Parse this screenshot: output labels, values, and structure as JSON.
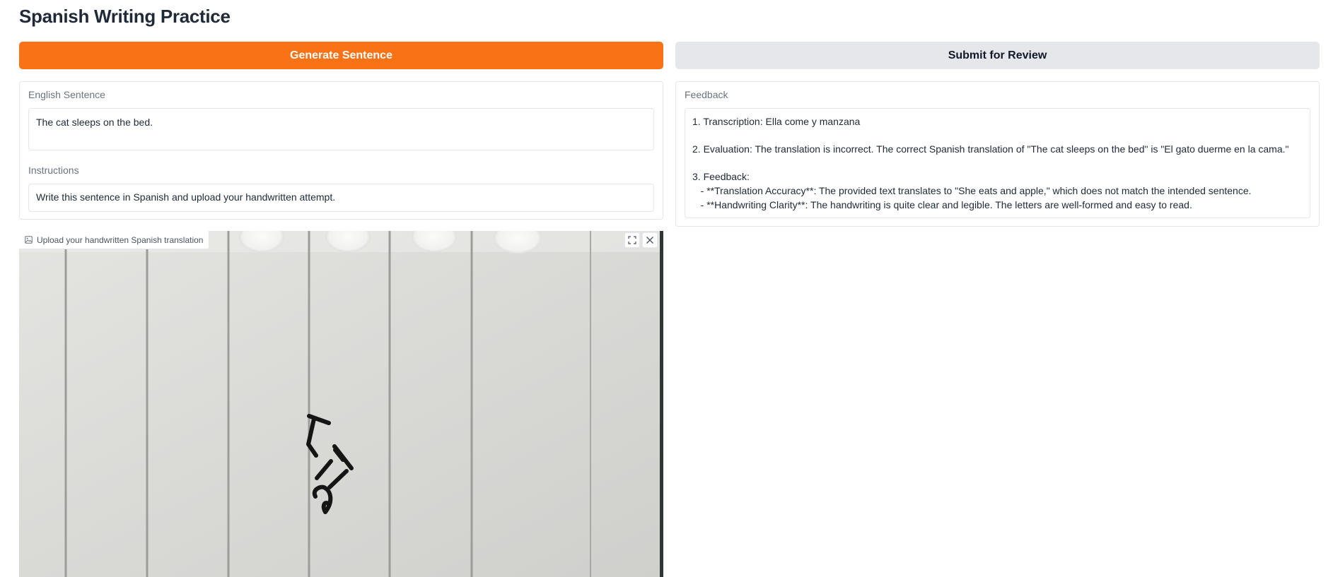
{
  "app": {
    "title": "Spanish Writing Practice"
  },
  "buttons": {
    "generate_label": "Generate Sentence",
    "submit_label": "Submit for Review"
  },
  "english": {
    "label": "English Sentence",
    "value": "The cat sleeps on the bed."
  },
  "instructions": {
    "label": "Instructions",
    "value": "Write this sentence in Spanish and upload your handwritten attempt."
  },
  "feedback": {
    "label": "Feedback",
    "lines": [
      "1. Transcription: Ella come y manzana",
      "",
      "2. Evaluation: The translation is incorrect. The correct Spanish translation of \"The cat sleeps on the bed\" is \"El gato duerme en la cama.\"",
      "",
      "3. Feedback:",
      "   - **Translation Accuracy**: The provided text translates to \"She eats and apple,\" which does not match the intended sentence.",
      "   - **Handwriting Clarity**: The handwriting is quite clear and legible. The letters are well-formed and easy to read."
    ]
  },
  "upload": {
    "label": "Upload your handwritten Spanish translation",
    "handwritten_text": "Ella"
  },
  "icons": {
    "image": "image-icon",
    "fullscreen": "fullscreen-icon",
    "close": "close-icon"
  },
  "colors": {
    "primary": "#f97316",
    "secondary": "#e5e7eb",
    "border": "#e5e7eb",
    "label": "#6b7280"
  }
}
